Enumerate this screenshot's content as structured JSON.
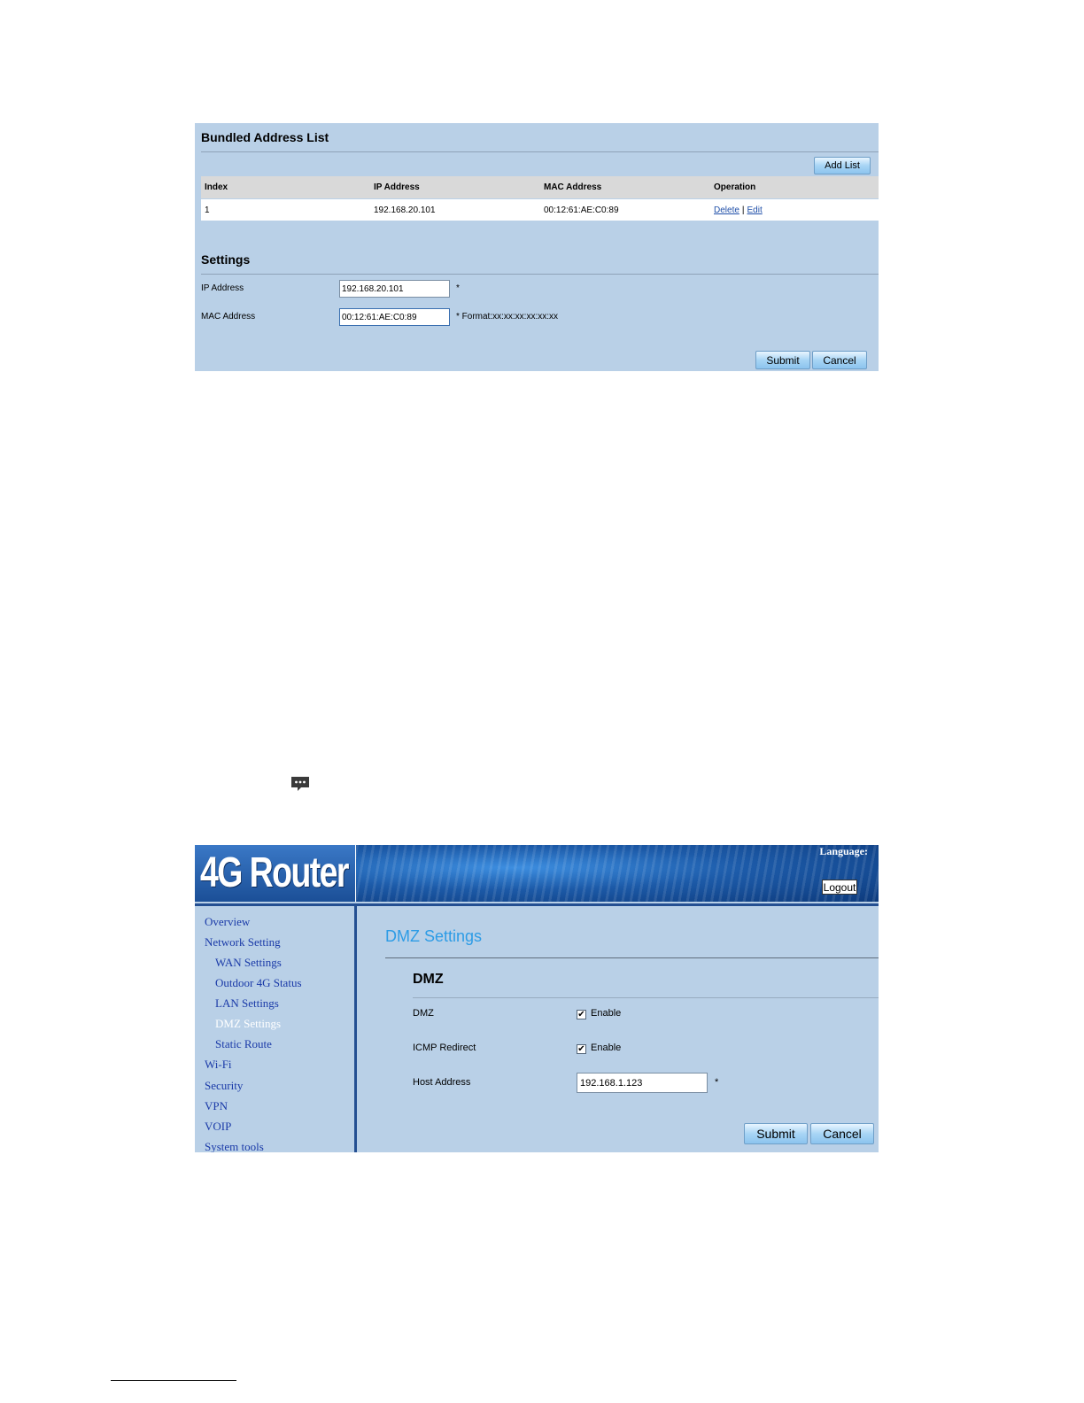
{
  "bundled": {
    "title": "Bundled Address List",
    "add_list_label": "Add List",
    "columns": [
      "Index",
      "IP Address",
      "MAC Address",
      "Operation"
    ],
    "rows": [
      {
        "index": "1",
        "ip": "192.168.20.101",
        "mac": "00:12:61:AE:C0:89",
        "delete": "Delete",
        "sep": "|",
        "edit": "Edit"
      }
    ]
  },
  "settings": {
    "title": "Settings",
    "ip_label": "IP Address",
    "ip_value": "192.168.20.101",
    "ip_note": "*",
    "mac_label": "MAC Address",
    "mac_value": "00:12:61:AE:C0:89",
    "mac_note": "* Format:xx:xx:xx:xx:xx:xx",
    "submit_label": "Submit",
    "cancel_label": "Cancel"
  },
  "router": {
    "logo": "4G Router",
    "language_label": "Language:",
    "logout_label": "Logout",
    "nav": [
      {
        "label": "Overview",
        "level": 0,
        "active": false
      },
      {
        "label": "Network Setting",
        "level": 0,
        "active": false
      },
      {
        "label": "WAN Settings",
        "level": 1,
        "active": false
      },
      {
        "label": "Outdoor 4G Status",
        "level": 1,
        "active": false
      },
      {
        "label": "LAN Settings",
        "level": 1,
        "active": false
      },
      {
        "label": "DMZ Settings",
        "level": 1,
        "active": true
      },
      {
        "label": "Static Route",
        "level": 1,
        "active": false
      },
      {
        "label": "Wi-Fi",
        "level": 0,
        "active": false
      },
      {
        "label": "Security",
        "level": 0,
        "active": false
      },
      {
        "label": "VPN",
        "level": 0,
        "active": false
      },
      {
        "label": "VOIP",
        "level": 0,
        "active": false
      },
      {
        "label": "System tools",
        "level": 0,
        "active": false
      }
    ],
    "page_title": "DMZ Settings",
    "section_title": "DMZ",
    "dmz_label": "DMZ",
    "dmz_enabled": true,
    "dmz_enable_label": "Enable",
    "icmp_label": "ICMP Redirect",
    "icmp_enabled": true,
    "icmp_enable_label": "Enable",
    "host_label": "Host Address",
    "host_value": "192.168.1.123",
    "host_note": "*",
    "submit_label": "Submit",
    "cancel_label": "Cancel"
  },
  "icons": {
    "chat": "chat-bubble-icon",
    "check": "✔"
  },
  "colors": {
    "panel_bg": "#b9d0e7",
    "link": "#1f4fa8",
    "nav_link": "#1a3aa8",
    "title_blue": "#2d9ce6",
    "banner_dark": "#244f92"
  }
}
